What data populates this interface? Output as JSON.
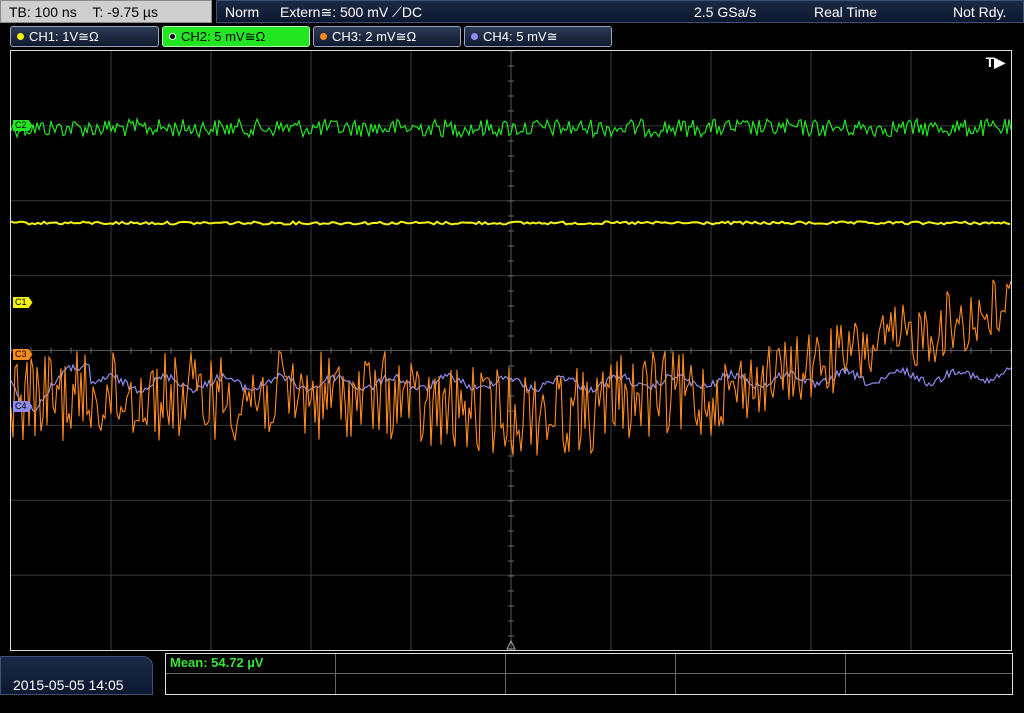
{
  "timebase": {
    "tb": "TB: 100 ns",
    "trigger_pos": "T: -9.75 µs"
  },
  "status": {
    "mode": "Norm",
    "trigger": "Extern≅: 500 mV ⟋DC",
    "sample_rate": "2.5 GSa/s",
    "acq": "Real Time",
    "state": "Not Rdy."
  },
  "channels": [
    {
      "label": "CH1: 1V≅Ω",
      "color": "#f4f40a",
      "active": false,
      "marker": "C1"
    },
    {
      "label": "CH2: 5 mV≅Ω",
      "color": "#23e623",
      "active": true,
      "marker": "C2"
    },
    {
      "label": "CH3: 2 mV≅Ω",
      "color": "#ff8a1c",
      "active": false,
      "marker": "C3"
    },
    {
      "label": "CH4: 5 mV≅",
      "color": "#8c8cf0",
      "active": false,
      "marker": "C4"
    }
  ],
  "trigger_marker": "T▶",
  "datetime": "2015-05-05 14:05",
  "measurement": {
    "mean": "Mean: 54.72 µV"
  },
  "colors": {
    "ch1": "#f4f40a",
    "ch2": "#23e623",
    "ch3": "#ff8a1c",
    "ch4": "#8c8cf0",
    "grid": "#3a3a3a"
  }
}
